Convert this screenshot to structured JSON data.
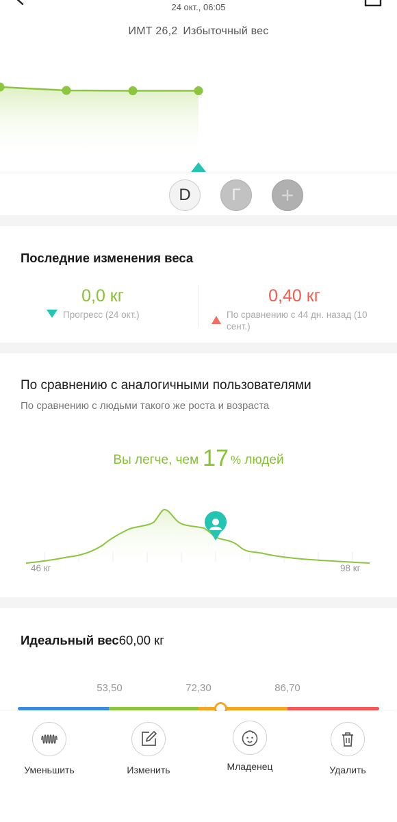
{
  "header": {
    "date": "24 окт., 06:05",
    "bmi_label": "ИМТ 26,2",
    "bmi_status": "Избыточный вес"
  },
  "profiles": [
    {
      "letter": "D"
    },
    {
      "letter": "Г"
    },
    {
      "letter": "+"
    }
  ],
  "recent_changes": {
    "title": "Последние изменения веса",
    "progress_value": "0,0 кг",
    "progress_note": "Прогресс (24 окт.)",
    "compare_value": "0,40 кг",
    "compare_note": "По сравнению с 44 дн. назад (10 сент.)"
  },
  "similar_users": {
    "title": "По сравнению с аналогичными пользователями",
    "subtitle": "По сравнению с людьми такого же роста и возраста",
    "lighter_prefix": "Вы легче, чем",
    "lighter_percent": "17",
    "lighter_percent_sign": "%",
    "lighter_suffix": "людей",
    "axis_min": "46 кг",
    "axis_max": "98 кг"
  },
  "ideal_weight": {
    "label": "Идеальный вес",
    "value": "60,00 кг",
    "thresholds": [
      "53,50",
      "72,30",
      "86,70"
    ]
  },
  "actions": [
    {
      "label": "Уменьшить",
      "icon": "wave-icon"
    },
    {
      "label": "Изменить",
      "icon": "edit-icon"
    },
    {
      "label": "Младенец",
      "icon": "baby-icon"
    },
    {
      "label": "Удалить",
      "icon": "trash-icon"
    }
  ],
  "colors": {
    "accent_green": "#86c232",
    "teal": "#23c4b2",
    "red": "#f25a4d",
    "scale_blue": "#3a8ce0",
    "scale_green": "#8cc63f",
    "scale_orange": "#f5a623",
    "scale_red": "#f25a5a"
  }
}
